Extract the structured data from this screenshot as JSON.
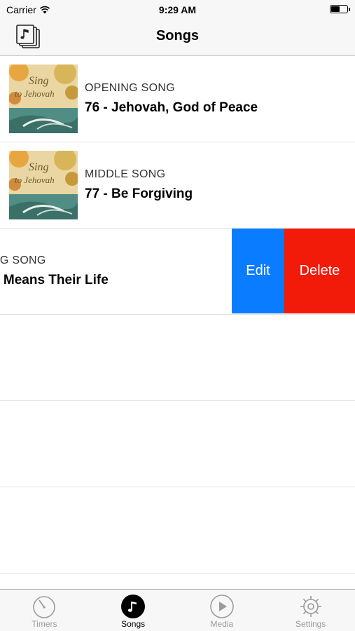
{
  "status_bar": {
    "carrier": "Carrier",
    "time": "9:29 AM",
    "battery_level": 0.55
  },
  "nav": {
    "title": "Songs",
    "left_icon": "songbook-icon"
  },
  "rows": [
    {
      "caption": "OPENING SONG",
      "title": "76 - Jehovah, God of Peace",
      "cover_line1": "Sing",
      "cover_line2": "to Jehovah"
    },
    {
      "caption": "MIDDLE SONG",
      "title": "77 - Be Forgiving",
      "cover_line1": "Sing",
      "cover_line2": "to Jehovah"
    },
    {
      "caption": "NG SONG",
      "title": "It Means Their Life"
    }
  ],
  "swipe_actions": {
    "edit": "Edit",
    "delete": "Delete",
    "edit_color": "#0a7cff",
    "delete_color": "#f21a08"
  },
  "empty_rows": 3,
  "tabbar": {
    "items": [
      {
        "label": "Timers",
        "icon": "timer-icon"
      },
      {
        "label": "Songs",
        "icon": "music-note-icon",
        "active": true
      },
      {
        "label": "Media",
        "icon": "play-icon"
      },
      {
        "label": "Settings",
        "icon": "gear-icon"
      }
    ]
  }
}
